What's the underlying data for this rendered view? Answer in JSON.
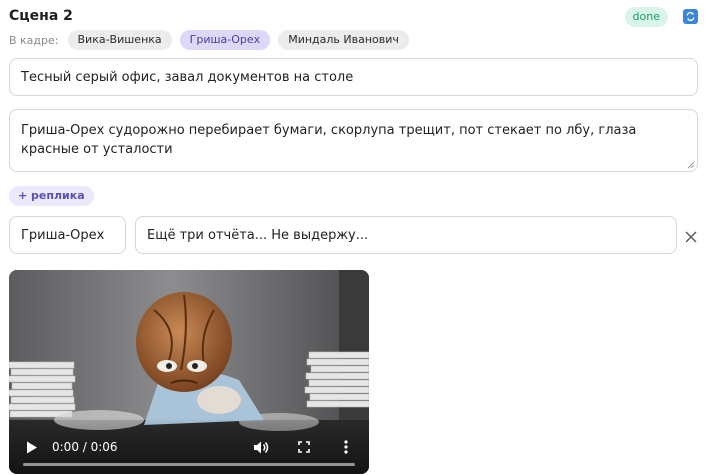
{
  "scene": {
    "title": "Сцена 2",
    "status": "done",
    "cast_label": "В кадре:",
    "characters": [
      {
        "name": "Вика-Вишенка",
        "active": false
      },
      {
        "name": "Гриша-Орех",
        "active": true
      },
      {
        "name": "Миндаль Иванович",
        "active": false
      }
    ],
    "location": "Тесный серый офис, завал документов на столе",
    "description": "Гриша-Орех судорожно перебирает бумаги, скорлупа трещит, пот стекает по лбу, глаза красные от усталости",
    "add_line_label": "+ реплика",
    "dialogue": [
      {
        "speaker": "Гриша-Орех",
        "text": "Ещё три отчёта... Не выдержу..."
      }
    ]
  },
  "video": {
    "time": "0:00 / 0:06",
    "progress": 0
  },
  "colors": {
    "status_bg": "#d9f5ea",
    "status_text": "#1e9a6a",
    "active_chip_bg": "#ddd8f7",
    "accent_purple": "#5a4fb8",
    "refresh_blue": "#3a86d8"
  },
  "icons": {
    "refresh": "refresh-icon",
    "remove": "close-icon",
    "play": "play-icon",
    "volume": "volume-icon",
    "fullscreen": "fullscreen-icon",
    "more": "more-vertical-icon"
  }
}
